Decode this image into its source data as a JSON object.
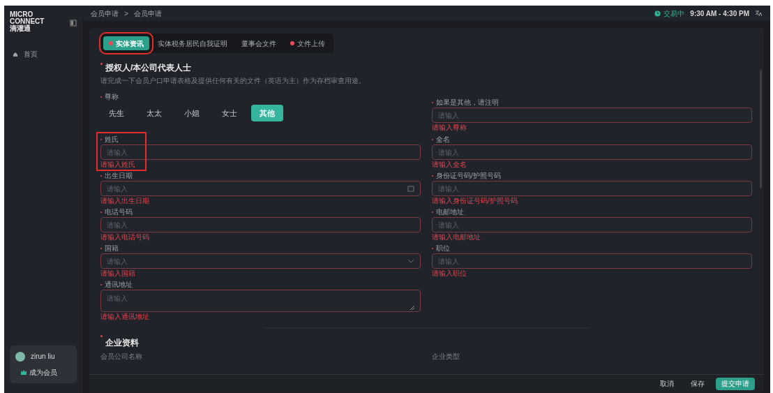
{
  "sidebar": {
    "logo": {
      "line1": "MICRO",
      "line2": "CONNECT",
      "line3": "滴灌通"
    },
    "items": [
      {
        "label": "首页",
        "selected": false
      }
    ],
    "user": {
      "name": "zirun liu",
      "action": "成为会员"
    }
  },
  "topbar": {
    "breadcrumb": [
      "会员申请",
      "会员申请"
    ],
    "separator": ">",
    "status": "交易中",
    "hours": "9:30 AM - 4:30 PM"
  },
  "tabs": [
    {
      "label": "实体资讯",
      "selected": true,
      "dot": true,
      "highlighted": true
    },
    {
      "label": "实体税务居民自我证明",
      "selected": false,
      "dot": false,
      "highlighted": false
    },
    {
      "label": "董事会文件",
      "selected": false,
      "dot": false,
      "highlighted": false
    },
    {
      "label": "文件上传",
      "selected": false,
      "dot": true,
      "highlighted": false
    }
  ],
  "section": {
    "title": "授权人/本公司代表人士",
    "required": true,
    "description": "请完成一下会员户口申请表格及提供任何有关的文件（英语为主）作为存档审查用途。",
    "salutation": {
      "label": "尊称",
      "options": [
        {
          "label": "先生",
          "selected": false
        },
        {
          "label": "太太",
          "selected": false
        },
        {
          "label": "小姐",
          "selected": false
        },
        {
          "label": "女士",
          "selected": false
        },
        {
          "label": "其他",
          "selected": true
        }
      ]
    },
    "other": {
      "label": "如果是其他，请注明",
      "placeholder": "请输入",
      "error": "请输入尊称"
    },
    "rows": [
      [
        {
          "kind": "text",
          "label": "姓氏",
          "placeholder": "请输入",
          "error": "请输入姓氏",
          "highlighted": true
        },
        {
          "kind": "text",
          "label": "全名",
          "placeholder": "请输入",
          "error": "请输入全名"
        }
      ],
      [
        {
          "kind": "date",
          "label": "出生日期",
          "placeholder": "请输入",
          "error": "请输入出生日期"
        },
        {
          "kind": "text",
          "label": "身份证号码/护照号码",
          "placeholder": "请输入",
          "error": "请输入身份证号码/护照号码"
        }
      ],
      [
        {
          "kind": "text",
          "label": "电话号码",
          "placeholder": "请输入",
          "error": "请输入电话号码"
        },
        {
          "kind": "text",
          "label": "电邮地址",
          "placeholder": "请输入",
          "error": "请输入电邮地址"
        }
      ],
      [
        {
          "kind": "select",
          "label": "国籍",
          "placeholder": "请输入",
          "error": "请输入国籍"
        },
        {
          "kind": "text",
          "label": "职位",
          "placeholder": "请输入",
          "error": "请输入职位"
        }
      ],
      [
        {
          "kind": "textarea",
          "label": "通讯地址",
          "placeholder": "请输入",
          "error": "请输入通讯地址"
        }
      ]
    ]
  },
  "section2": {
    "title": "企业资料",
    "required": true,
    "labels": [
      "会员公司名称",
      "企业类型"
    ]
  },
  "footer": {
    "buttons": [
      {
        "label": "取消",
        "kind": "plain"
      },
      {
        "label": "保存",
        "kind": "plain"
      },
      {
        "label": "提交申请",
        "kind": "primary"
      }
    ]
  }
}
